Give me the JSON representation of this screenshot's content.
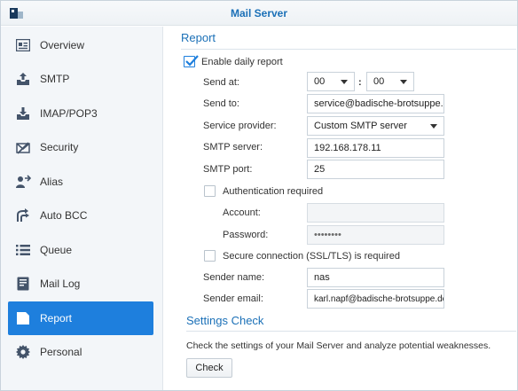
{
  "window": {
    "title": "Mail Server"
  },
  "sidebar": {
    "items": [
      {
        "label": "Overview",
        "icon": "overview-icon"
      },
      {
        "label": "SMTP",
        "icon": "outbox-icon"
      },
      {
        "label": "IMAP/POP3",
        "icon": "inbox-icon"
      },
      {
        "label": "Security",
        "icon": "security-icon"
      },
      {
        "label": "Alias",
        "icon": "alias-icon"
      },
      {
        "label": "Auto BCC",
        "icon": "auto-bcc-icon"
      },
      {
        "label": "Queue",
        "icon": "queue-icon"
      },
      {
        "label": "Mail Log",
        "icon": "mail-log-icon"
      },
      {
        "label": "Report",
        "icon": "report-icon",
        "active": true
      },
      {
        "label": "Personal",
        "icon": "gear-icon"
      }
    ]
  },
  "report": {
    "section_title": "Report",
    "enable_daily_report": {
      "label": "Enable daily report",
      "checked": true
    },
    "send_at": {
      "label": "Send at:",
      "hour": "00",
      "separator": ":",
      "minute": "00"
    },
    "send_to": {
      "label": "Send to:",
      "value": "service@badische-brotsuppe.de"
    },
    "service_provider": {
      "label": "Service provider:",
      "value": "Custom SMTP server"
    },
    "smtp_server": {
      "label": "SMTP server:",
      "value": "192.168.178.11"
    },
    "smtp_port": {
      "label": "SMTP port:",
      "value": "25"
    },
    "auth_required": {
      "label": "Authentication required",
      "checked": false
    },
    "account": {
      "label": "Account:",
      "value": ""
    },
    "password": {
      "label": "Password:",
      "value": "••••••••"
    },
    "secure_connection": {
      "label": "Secure connection (SSL/TLS) is required",
      "checked": false
    },
    "sender_name": {
      "label": "Sender name:",
      "value": "nas"
    },
    "sender_email": {
      "label": "Sender email:",
      "value": "karl.napf@badische-brotsuppe.de"
    }
  },
  "settings_check": {
    "section_title": "Settings Check",
    "description": "Check the settings of your Mail Server and analyze potential weaknesses.",
    "button_label": "Check"
  },
  "colors": {
    "accent": "#1e7fdd",
    "title_blue": "#1b70b7"
  }
}
